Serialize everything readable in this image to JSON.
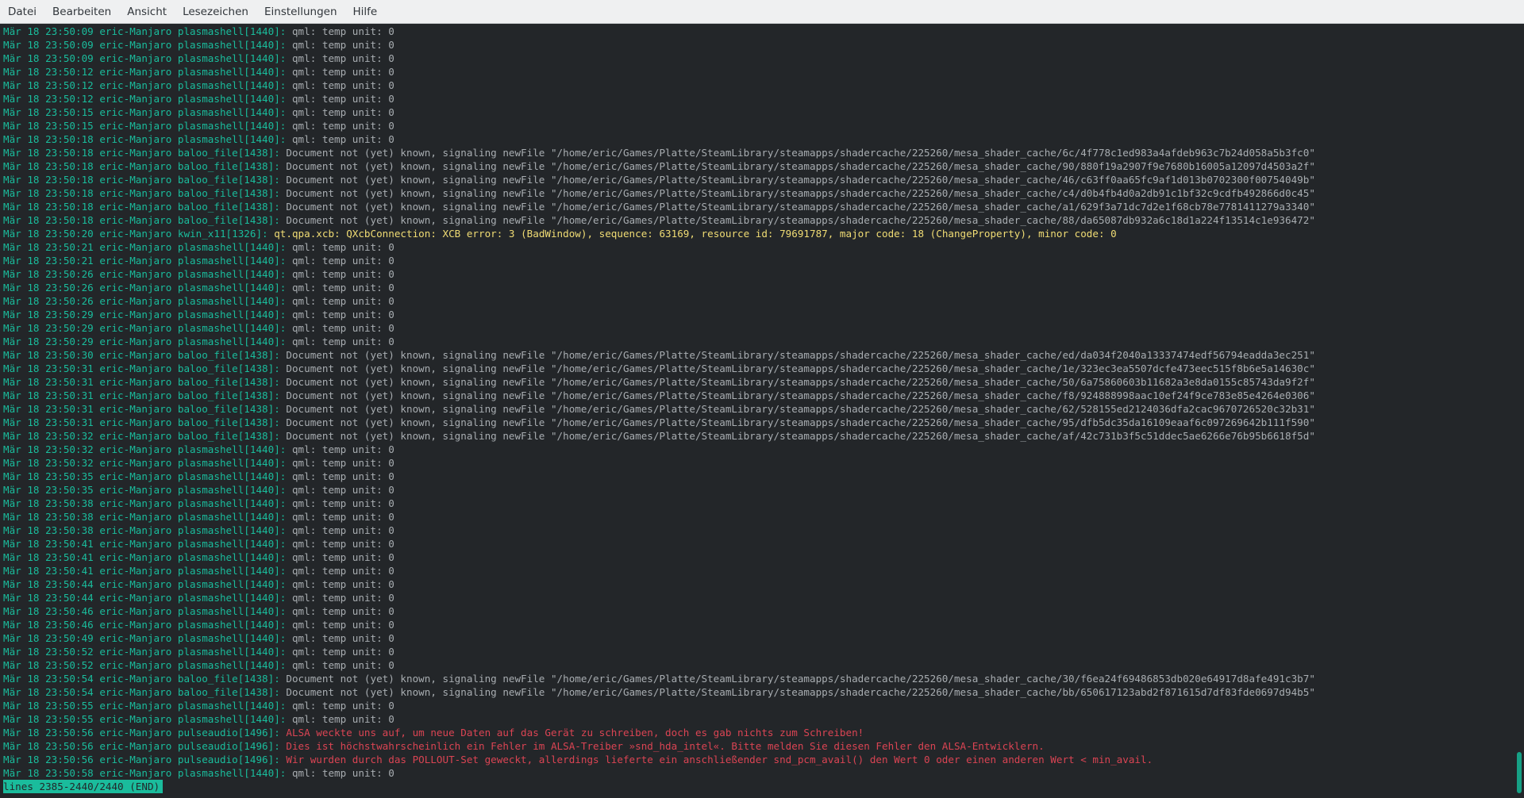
{
  "menu": [
    "Datei",
    "Bearbeiten",
    "Ansicht",
    "Lesezeichen",
    "Einstellungen",
    "Hilfe"
  ],
  "status_line": "lines 2385-2440/2440 (END)",
  "colors": {
    "background": "#232629",
    "timestamp": "#1abc9c",
    "message": "#a8adb1",
    "warning": "#f0dc74",
    "error": "#da4453"
  },
  "lines": [
    {
      "prefix": "Mär 18 23:50:09 eric-Manjaro plasmashell[1440]: ",
      "msg": "qml: temp unit: 0",
      "level": "normal"
    },
    {
      "prefix": "Mär 18 23:50:09 eric-Manjaro plasmashell[1440]: ",
      "msg": "qml: temp unit: 0",
      "level": "normal"
    },
    {
      "prefix": "Mär 18 23:50:09 eric-Manjaro plasmashell[1440]: ",
      "msg": "qml: temp unit: 0",
      "level": "normal"
    },
    {
      "prefix": "Mär 18 23:50:12 eric-Manjaro plasmashell[1440]: ",
      "msg": "qml: temp unit: 0",
      "level": "normal"
    },
    {
      "prefix": "Mär 18 23:50:12 eric-Manjaro plasmashell[1440]: ",
      "msg": "qml: temp unit: 0",
      "level": "normal"
    },
    {
      "prefix": "Mär 18 23:50:12 eric-Manjaro plasmashell[1440]: ",
      "msg": "qml: temp unit: 0",
      "level": "normal"
    },
    {
      "prefix": "Mär 18 23:50:15 eric-Manjaro plasmashell[1440]: ",
      "msg": "qml: temp unit: 0",
      "level": "normal"
    },
    {
      "prefix": "Mär 18 23:50:15 eric-Manjaro plasmashell[1440]: ",
      "msg": "qml: temp unit: 0",
      "level": "normal"
    },
    {
      "prefix": "Mär 18 23:50:18 eric-Manjaro plasmashell[1440]: ",
      "msg": "qml: temp unit: 0",
      "level": "normal"
    },
    {
      "prefix": "Mär 18 23:50:18 eric-Manjaro baloo_file[1438]: ",
      "msg": "Document not (yet) known, signaling newFile \"/home/eric/Games/Platte/SteamLibrary/steamapps/shadercache/225260/mesa_shader_cache/6c/4f778c1ed983a4afdeb963c7b24d058a5b3fc0\"",
      "level": "normal"
    },
    {
      "prefix": "Mär 18 23:50:18 eric-Manjaro baloo_file[1438]: ",
      "msg": "Document not (yet) known, signaling newFile \"/home/eric/Games/Platte/SteamLibrary/steamapps/shadercache/225260/mesa_shader_cache/90/880f19a2907f9e7680b16005a12097d4503a2f\"",
      "level": "normal"
    },
    {
      "prefix": "Mär 18 23:50:18 eric-Manjaro baloo_file[1438]: ",
      "msg": "Document not (yet) known, signaling newFile \"/home/eric/Games/Platte/SteamLibrary/steamapps/shadercache/225260/mesa_shader_cache/46/c63ff0aa65fc9af1d013b0702300f00754049b\"",
      "level": "normal"
    },
    {
      "prefix": "Mär 18 23:50:18 eric-Manjaro baloo_file[1438]: ",
      "msg": "Document not (yet) known, signaling newFile \"/home/eric/Games/Platte/SteamLibrary/steamapps/shadercache/225260/mesa_shader_cache/c4/d0b4fb4d0a2db91c1bf32c9cdfb492866d0c45\"",
      "level": "normal"
    },
    {
      "prefix": "Mär 18 23:50:18 eric-Manjaro baloo_file[1438]: ",
      "msg": "Document not (yet) known, signaling newFile \"/home/eric/Games/Platte/SteamLibrary/steamapps/shadercache/225260/mesa_shader_cache/a1/629f3a71dc7d2e1f68cb78e7781411279a3340\"",
      "level": "normal"
    },
    {
      "prefix": "Mär 18 23:50:18 eric-Manjaro baloo_file[1438]: ",
      "msg": "Document not (yet) known, signaling newFile \"/home/eric/Games/Platte/SteamLibrary/steamapps/shadercache/225260/mesa_shader_cache/88/da65087db932a6c18d1a224f13514c1e936472\"",
      "level": "normal"
    },
    {
      "prefix": "Mär 18 23:50:20 eric-Manjaro kwin_x11[1326]: ",
      "msg": "qt.qpa.xcb: QXcbConnection: XCB error: 3 (BadWindow), sequence: 63169, resource id: 79691787, major code: 18 (ChangeProperty), minor code: 0",
      "level": "warn"
    },
    {
      "prefix": "Mär 18 23:50:21 eric-Manjaro plasmashell[1440]: ",
      "msg": "qml: temp unit: 0",
      "level": "normal"
    },
    {
      "prefix": "Mär 18 23:50:21 eric-Manjaro plasmashell[1440]: ",
      "msg": "qml: temp unit: 0",
      "level": "normal"
    },
    {
      "prefix": "Mär 18 23:50:26 eric-Manjaro plasmashell[1440]: ",
      "msg": "qml: temp unit: 0",
      "level": "normal"
    },
    {
      "prefix": "Mär 18 23:50:26 eric-Manjaro plasmashell[1440]: ",
      "msg": "qml: temp unit: 0",
      "level": "normal"
    },
    {
      "prefix": "Mär 18 23:50:26 eric-Manjaro plasmashell[1440]: ",
      "msg": "qml: temp unit: 0",
      "level": "normal"
    },
    {
      "prefix": "Mär 18 23:50:29 eric-Manjaro plasmashell[1440]: ",
      "msg": "qml: temp unit: 0",
      "level": "normal"
    },
    {
      "prefix": "Mär 18 23:50:29 eric-Manjaro plasmashell[1440]: ",
      "msg": "qml: temp unit: 0",
      "level": "normal"
    },
    {
      "prefix": "Mär 18 23:50:29 eric-Manjaro plasmashell[1440]: ",
      "msg": "qml: temp unit: 0",
      "level": "normal"
    },
    {
      "prefix": "Mär 18 23:50:30 eric-Manjaro baloo_file[1438]: ",
      "msg": "Document not (yet) known, signaling newFile \"/home/eric/Games/Platte/SteamLibrary/steamapps/shadercache/225260/mesa_shader_cache/ed/da034f2040a13337474edf56794eadda3ec251\"",
      "level": "normal"
    },
    {
      "prefix": "Mär 18 23:50:31 eric-Manjaro baloo_file[1438]: ",
      "msg": "Document not (yet) known, signaling newFile \"/home/eric/Games/Platte/SteamLibrary/steamapps/shadercache/225260/mesa_shader_cache/1e/323ec3ea5507dcfe473eec515f8b6e5a14630c\"",
      "level": "normal"
    },
    {
      "prefix": "Mär 18 23:50:31 eric-Manjaro baloo_file[1438]: ",
      "msg": "Document not (yet) known, signaling newFile \"/home/eric/Games/Platte/SteamLibrary/steamapps/shadercache/225260/mesa_shader_cache/50/6a75860603b11682a3e8da0155c85743da9f2f\"",
      "level": "normal"
    },
    {
      "prefix": "Mär 18 23:50:31 eric-Manjaro baloo_file[1438]: ",
      "msg": "Document not (yet) known, signaling newFile \"/home/eric/Games/Platte/SteamLibrary/steamapps/shadercache/225260/mesa_shader_cache/f8/924888998aac10ef24f9ce783e85e4264e0306\"",
      "level": "normal"
    },
    {
      "prefix": "Mär 18 23:50:31 eric-Manjaro baloo_file[1438]: ",
      "msg": "Document not (yet) known, signaling newFile \"/home/eric/Games/Platte/SteamLibrary/steamapps/shadercache/225260/mesa_shader_cache/62/528155ed2124036dfa2cac9670726520c32b31\"",
      "level": "normal"
    },
    {
      "prefix": "Mär 18 23:50:31 eric-Manjaro baloo_file[1438]: ",
      "msg": "Document not (yet) known, signaling newFile \"/home/eric/Games/Platte/SteamLibrary/steamapps/shadercache/225260/mesa_shader_cache/95/dfb5dc35da16109eaaf6c097269642b111f590\"",
      "level": "normal"
    },
    {
      "prefix": "Mär 18 23:50:32 eric-Manjaro baloo_file[1438]: ",
      "msg": "Document not (yet) known, signaling newFile \"/home/eric/Games/Platte/SteamLibrary/steamapps/shadercache/225260/mesa_shader_cache/af/42c731b3f5c51ddec5ae6266e76b95b6618f5d\"",
      "level": "normal"
    },
    {
      "prefix": "Mär 18 23:50:32 eric-Manjaro plasmashell[1440]: ",
      "msg": "qml: temp unit: 0",
      "level": "normal"
    },
    {
      "prefix": "Mär 18 23:50:32 eric-Manjaro plasmashell[1440]: ",
      "msg": "qml: temp unit: 0",
      "level": "normal"
    },
    {
      "prefix": "Mär 18 23:50:35 eric-Manjaro plasmashell[1440]: ",
      "msg": "qml: temp unit: 0",
      "level": "normal"
    },
    {
      "prefix": "Mär 18 23:50:35 eric-Manjaro plasmashell[1440]: ",
      "msg": "qml: temp unit: 0",
      "level": "normal"
    },
    {
      "prefix": "Mär 18 23:50:38 eric-Manjaro plasmashell[1440]: ",
      "msg": "qml: temp unit: 0",
      "level": "normal"
    },
    {
      "prefix": "Mär 18 23:50:38 eric-Manjaro plasmashell[1440]: ",
      "msg": "qml: temp unit: 0",
      "level": "normal"
    },
    {
      "prefix": "Mär 18 23:50:38 eric-Manjaro plasmashell[1440]: ",
      "msg": "qml: temp unit: 0",
      "level": "normal"
    },
    {
      "prefix": "Mär 18 23:50:41 eric-Manjaro plasmashell[1440]: ",
      "msg": "qml: temp unit: 0",
      "level": "normal"
    },
    {
      "prefix": "Mär 18 23:50:41 eric-Manjaro plasmashell[1440]: ",
      "msg": "qml: temp unit: 0",
      "level": "normal"
    },
    {
      "prefix": "Mär 18 23:50:41 eric-Manjaro plasmashell[1440]: ",
      "msg": "qml: temp unit: 0",
      "level": "normal"
    },
    {
      "prefix": "Mär 18 23:50:44 eric-Manjaro plasmashell[1440]: ",
      "msg": "qml: temp unit: 0",
      "level": "normal"
    },
    {
      "prefix": "Mär 18 23:50:44 eric-Manjaro plasmashell[1440]: ",
      "msg": "qml: temp unit: 0",
      "level": "normal"
    },
    {
      "prefix": "Mär 18 23:50:46 eric-Manjaro plasmashell[1440]: ",
      "msg": "qml: temp unit: 0",
      "level": "normal"
    },
    {
      "prefix": "Mär 18 23:50:46 eric-Manjaro plasmashell[1440]: ",
      "msg": "qml: temp unit: 0",
      "level": "normal"
    },
    {
      "prefix": "Mär 18 23:50:49 eric-Manjaro plasmashell[1440]: ",
      "msg": "qml: temp unit: 0",
      "level": "normal"
    },
    {
      "prefix": "Mär 18 23:50:52 eric-Manjaro plasmashell[1440]: ",
      "msg": "qml: temp unit: 0",
      "level": "normal"
    },
    {
      "prefix": "Mär 18 23:50:52 eric-Manjaro plasmashell[1440]: ",
      "msg": "qml: temp unit: 0",
      "level": "normal"
    },
    {
      "prefix": "Mär 18 23:50:54 eric-Manjaro baloo_file[1438]: ",
      "msg": "Document not (yet) known, signaling newFile \"/home/eric/Games/Platte/SteamLibrary/steamapps/shadercache/225260/mesa_shader_cache/30/f6ea24f69486853db020e64917d8afe491c3b7\"",
      "level": "normal"
    },
    {
      "prefix": "Mär 18 23:50:54 eric-Manjaro baloo_file[1438]: ",
      "msg": "Document not (yet) known, signaling newFile \"/home/eric/Games/Platte/SteamLibrary/steamapps/shadercache/225260/mesa_shader_cache/bb/650617123abd2f871615d7df83fde0697d94b5\"",
      "level": "normal"
    },
    {
      "prefix": "Mär 18 23:50:55 eric-Manjaro plasmashell[1440]: ",
      "msg": "qml: temp unit: 0",
      "level": "normal"
    },
    {
      "prefix": "Mär 18 23:50:55 eric-Manjaro plasmashell[1440]: ",
      "msg": "qml: temp unit: 0",
      "level": "normal"
    },
    {
      "prefix": "Mär 18 23:50:56 eric-Manjaro pulseaudio[1496]: ",
      "msg": "ALSA weckte uns auf, um neue Daten auf das Gerät zu schreiben, doch es gab nichts zum Schreiben!",
      "level": "error"
    },
    {
      "prefix": "Mär 18 23:50:56 eric-Manjaro pulseaudio[1496]: ",
      "msg": "Dies ist höchstwahrscheinlich ein Fehler im ALSA-Treiber »snd_hda_intel«. Bitte melden Sie diesen Fehler den ALSA-Entwicklern.",
      "level": "error"
    },
    {
      "prefix": "Mär 18 23:50:56 eric-Manjaro pulseaudio[1496]: ",
      "msg": "Wir wurden durch das POLLOUT-Set geweckt, allerdings lieferte ein anschließender snd_pcm_avail() den Wert 0 oder einen anderen Wert < min_avail.",
      "level": "error"
    },
    {
      "prefix": "Mär 18 23:50:58 eric-Manjaro plasmashell[1440]: ",
      "msg": "qml: temp unit: 0",
      "level": "normal"
    }
  ]
}
